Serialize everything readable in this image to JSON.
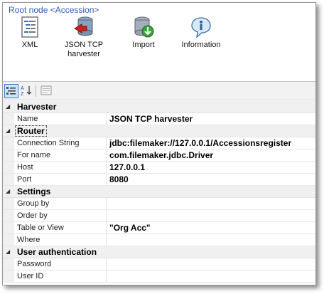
{
  "breadcrumb": "Root node <Accession>",
  "toolbar": {
    "items": [
      {
        "label": "XML",
        "icon": "xml-document-icon"
      },
      {
        "label": "JSON TCP\nharvester",
        "icon": "harvester-icon"
      },
      {
        "label": "Import",
        "icon": "database-import-icon"
      },
      {
        "label": "Information",
        "icon": "information-icon"
      }
    ]
  },
  "property_grid": {
    "toolbar": [
      "categorized-view-icon",
      "alphabetical-sort-icon",
      "property-pages-icon"
    ],
    "categories": [
      {
        "name": "Harvester",
        "properties": [
          {
            "name": "Name",
            "value": "JSON TCP harvester"
          }
        ]
      },
      {
        "name": "Router",
        "properties": [
          {
            "name": "Connection String",
            "value": "jdbc:filemaker://127.0.0.1/Accessionsregister"
          },
          {
            "name": "For name",
            "value": "com.filemaker.jdbc.Driver"
          },
          {
            "name": "Host",
            "value": "127.0.0.1"
          },
          {
            "name": "Port",
            "value": "8080"
          }
        ]
      },
      {
        "name": "Settings",
        "properties": [
          {
            "name": "Group by",
            "value": ""
          },
          {
            "name": "Order by",
            "value": ""
          },
          {
            "name": "Table or View",
            "value": "\"Org Acc\""
          },
          {
            "name": "Where",
            "value": ""
          }
        ]
      },
      {
        "name": "User authentication",
        "properties": [
          {
            "name": "Password",
            "value": ""
          },
          {
            "name": "User ID",
            "value": ""
          }
        ]
      }
    ]
  }
}
